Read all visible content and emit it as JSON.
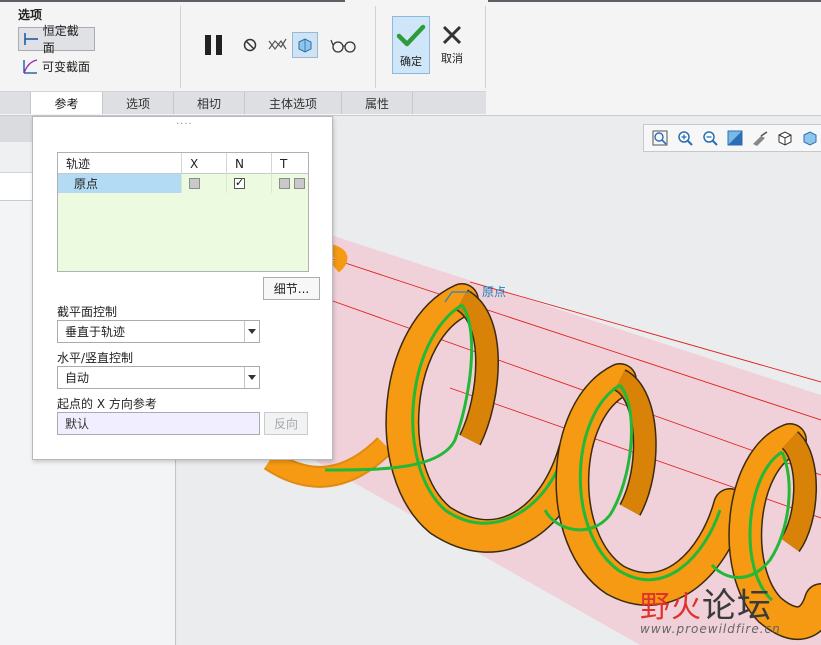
{
  "ribbon": {
    "group_title": "选项",
    "constant_section": "恒定截面",
    "variable_section": "可变截面",
    "ok_label": "确定",
    "cancel_label": "取消",
    "tools": [
      "pause-icon",
      "stop-icon",
      "preview-geometry-icon",
      "verify-mode-icon",
      "glasses-preview-icon"
    ]
  },
  "tabs": [
    {
      "label": "参考",
      "selected": true
    },
    {
      "label": "选项",
      "selected": false
    },
    {
      "label": "相切",
      "selected": false
    },
    {
      "label": "主体选项",
      "selected": false
    },
    {
      "label": "属性",
      "selected": false
    }
  ],
  "panel": {
    "grip": "····",
    "table": {
      "headers": [
        "轨迹",
        "X",
        "N",
        "T"
      ],
      "rows": [
        {
          "name": "原点",
          "x": "grey",
          "n": "checked",
          "t": [
            "grey",
            "grey"
          ]
        }
      ]
    },
    "details_button": "细节...",
    "section_plane_label": "截平面控制",
    "section_plane_value": "垂直于轨迹",
    "hv_control_label": "水平/竖直控制",
    "hv_control_value": "自动",
    "x_ref_label": "起点的 X 方向参考",
    "x_ref_value": "默认",
    "flip_button": "反向"
  },
  "viewport": {
    "origin_label": "原点",
    "view_tools": [
      "refit-icon",
      "zoom-in-icon",
      "zoom-out-icon",
      "repaint-icon",
      "orientation-icon",
      "saved-views-icon",
      "display-style-icon"
    ],
    "watermark_text": "论坛",
    "watermark_red": "野火",
    "watermark_url": "www.proewildfire.cn",
    "colors": {
      "spring": "#f59a12",
      "trajectory": "#22b838",
      "plane": "#f2cdd5",
      "plane_line": "#e02020"
    }
  }
}
